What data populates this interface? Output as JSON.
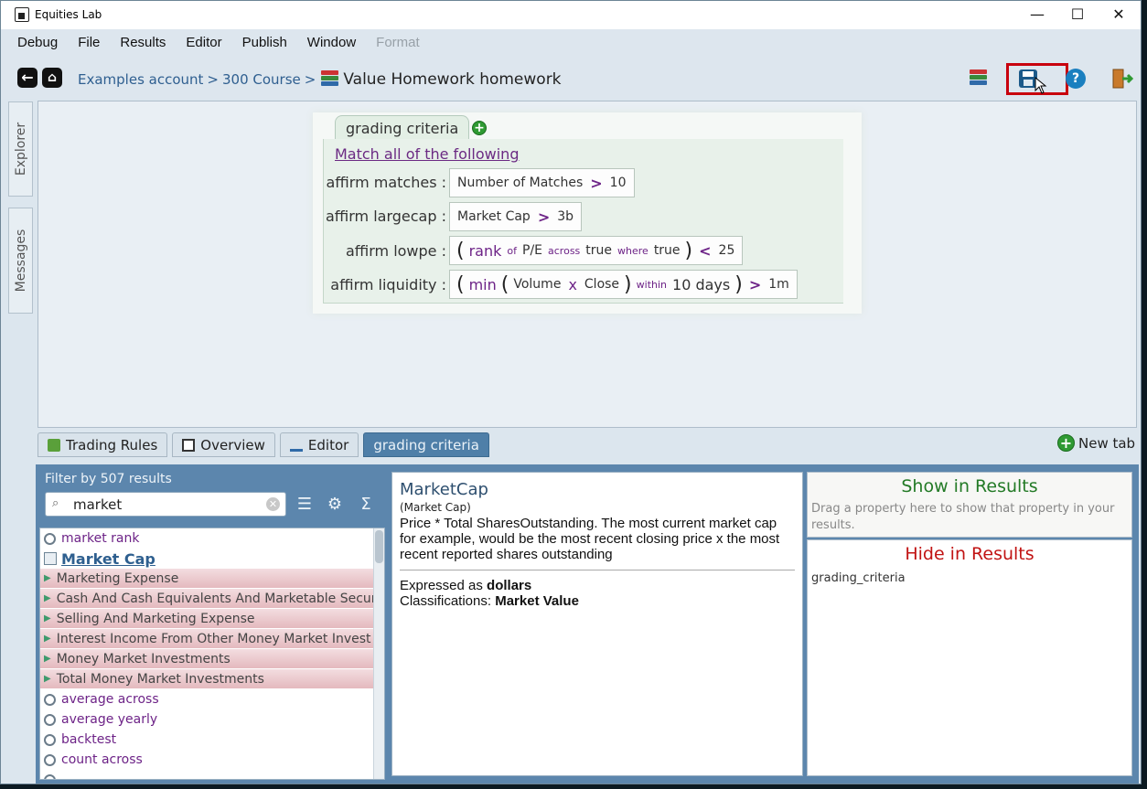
{
  "window": {
    "title": "Equities Lab",
    "controls": [
      "—",
      "☐",
      "✕"
    ]
  },
  "menu": [
    "Debug",
    "File",
    "Results",
    "Editor",
    "Publish",
    "Window",
    "Format"
  ],
  "breadcrumb": {
    "account": "Examples account",
    "course": "300 Course",
    "title": "Value Homework homework"
  },
  "side_tabs": [
    "Explorer",
    "Messages"
  ],
  "editor": {
    "tab_label": "grading criteria",
    "match_link": "Match all of the following",
    "rules": [
      {
        "label": "affirm matches :",
        "tokens": [
          "Number of Matches",
          ">",
          "10"
        ]
      },
      {
        "label": "affirm largecap :",
        "tokens": [
          "Market Cap",
          ">",
          "3b"
        ]
      },
      {
        "label": "affirm lowpe :",
        "tokens": [
          "(",
          "rank",
          "of",
          "P/E",
          "across",
          "true",
          "where",
          "true",
          ")",
          "<",
          "25"
        ]
      },
      {
        "label": "affirm liquidity :",
        "tokens": [
          "(",
          "min",
          "(",
          "Volume",
          "x",
          "Close",
          ")",
          "within",
          "10 days",
          ")",
          ">",
          "1m"
        ]
      }
    ]
  },
  "tabs": [
    {
      "label": "Trading Rules",
      "icon": "trading-rules-icon"
    },
    {
      "label": "Overview",
      "icon": "overview-icon"
    },
    {
      "label": "Editor",
      "icon": "editor-icon"
    },
    {
      "label": "grading criteria",
      "icon": ""
    }
  ],
  "new_tab_label": "New tab",
  "filter": {
    "label": "Filter by 507 results",
    "value": "market"
  },
  "results": [
    {
      "label": "market rank",
      "type": "function"
    },
    {
      "label": "Market Cap",
      "type": "selected"
    },
    {
      "label": "Marketing Expense",
      "type": "field"
    },
    {
      "label": "Cash And Cash Equivalents And Marketable Secur",
      "type": "field"
    },
    {
      "label": "Selling And Marketing Expense",
      "type": "field"
    },
    {
      "label": "Interest Income From Other Money Market Invest",
      "type": "field"
    },
    {
      "label": "Money Market Investments",
      "type": "field"
    },
    {
      "label": "Total Money Market Investments",
      "type": "field"
    },
    {
      "label": "average across",
      "type": "function"
    },
    {
      "label": "average yearly",
      "type": "function"
    },
    {
      "label": "backtest",
      "type": "function"
    },
    {
      "label": "count across",
      "type": "function"
    },
    {
      "label": "–",
      "type": "function"
    }
  ],
  "property": {
    "title": "MarketCap",
    "subtitle": "(Market Cap)",
    "description": "Price * Total SharesOutstanding. The most current market cap for example, would be the most recent closing price x the most recent reported shares outstanding",
    "expressed_prefix": "Expressed as ",
    "expressed_value": "dollars",
    "class_prefix": "Classifications: ",
    "class_value": "Market Value"
  },
  "show_results": {
    "title": "Show in Results",
    "hint": "Drag a property here to show that property in your results."
  },
  "hide_results": {
    "title": "Hide in Results",
    "items": [
      "grading_criteria"
    ]
  },
  "colors": {
    "accent": "#5c86ad",
    "link": "#6d2387",
    "highlight": "#c8000d"
  }
}
